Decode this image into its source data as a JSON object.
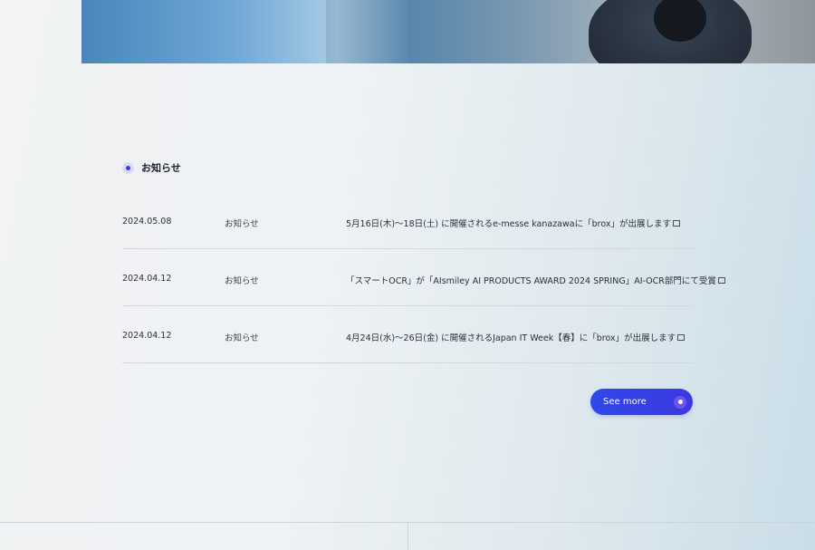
{
  "section": {
    "title": "お知らせ"
  },
  "news": [
    {
      "date": "2024.05.08",
      "category": "お知らせ",
      "title": "5月16日(木)～18日(土) に開催されるe-messe kanazawaに「brox」が出展します"
    },
    {
      "date": "2024.04.12",
      "category": "お知らせ",
      "title": "「スマートOCR」が「AIsmiley AI PRODUCTS AWARD 2024 SPRING」AI-OCR部門にて受賞"
    },
    {
      "date": "2024.04.12",
      "category": "お知らせ",
      "title": "4月24日(水)～26日(金) に開催されるJapan IT Week【春】に「brox」が出展します"
    }
  ],
  "see_more": {
    "label": "See more"
  },
  "icons": {
    "section_marker": "dot-icon",
    "external_link": "external-link-icon",
    "see_more": "circle-dot-icon"
  },
  "colors": {
    "accent": "#3d3ddc",
    "button": "#2f48e8"
  }
}
